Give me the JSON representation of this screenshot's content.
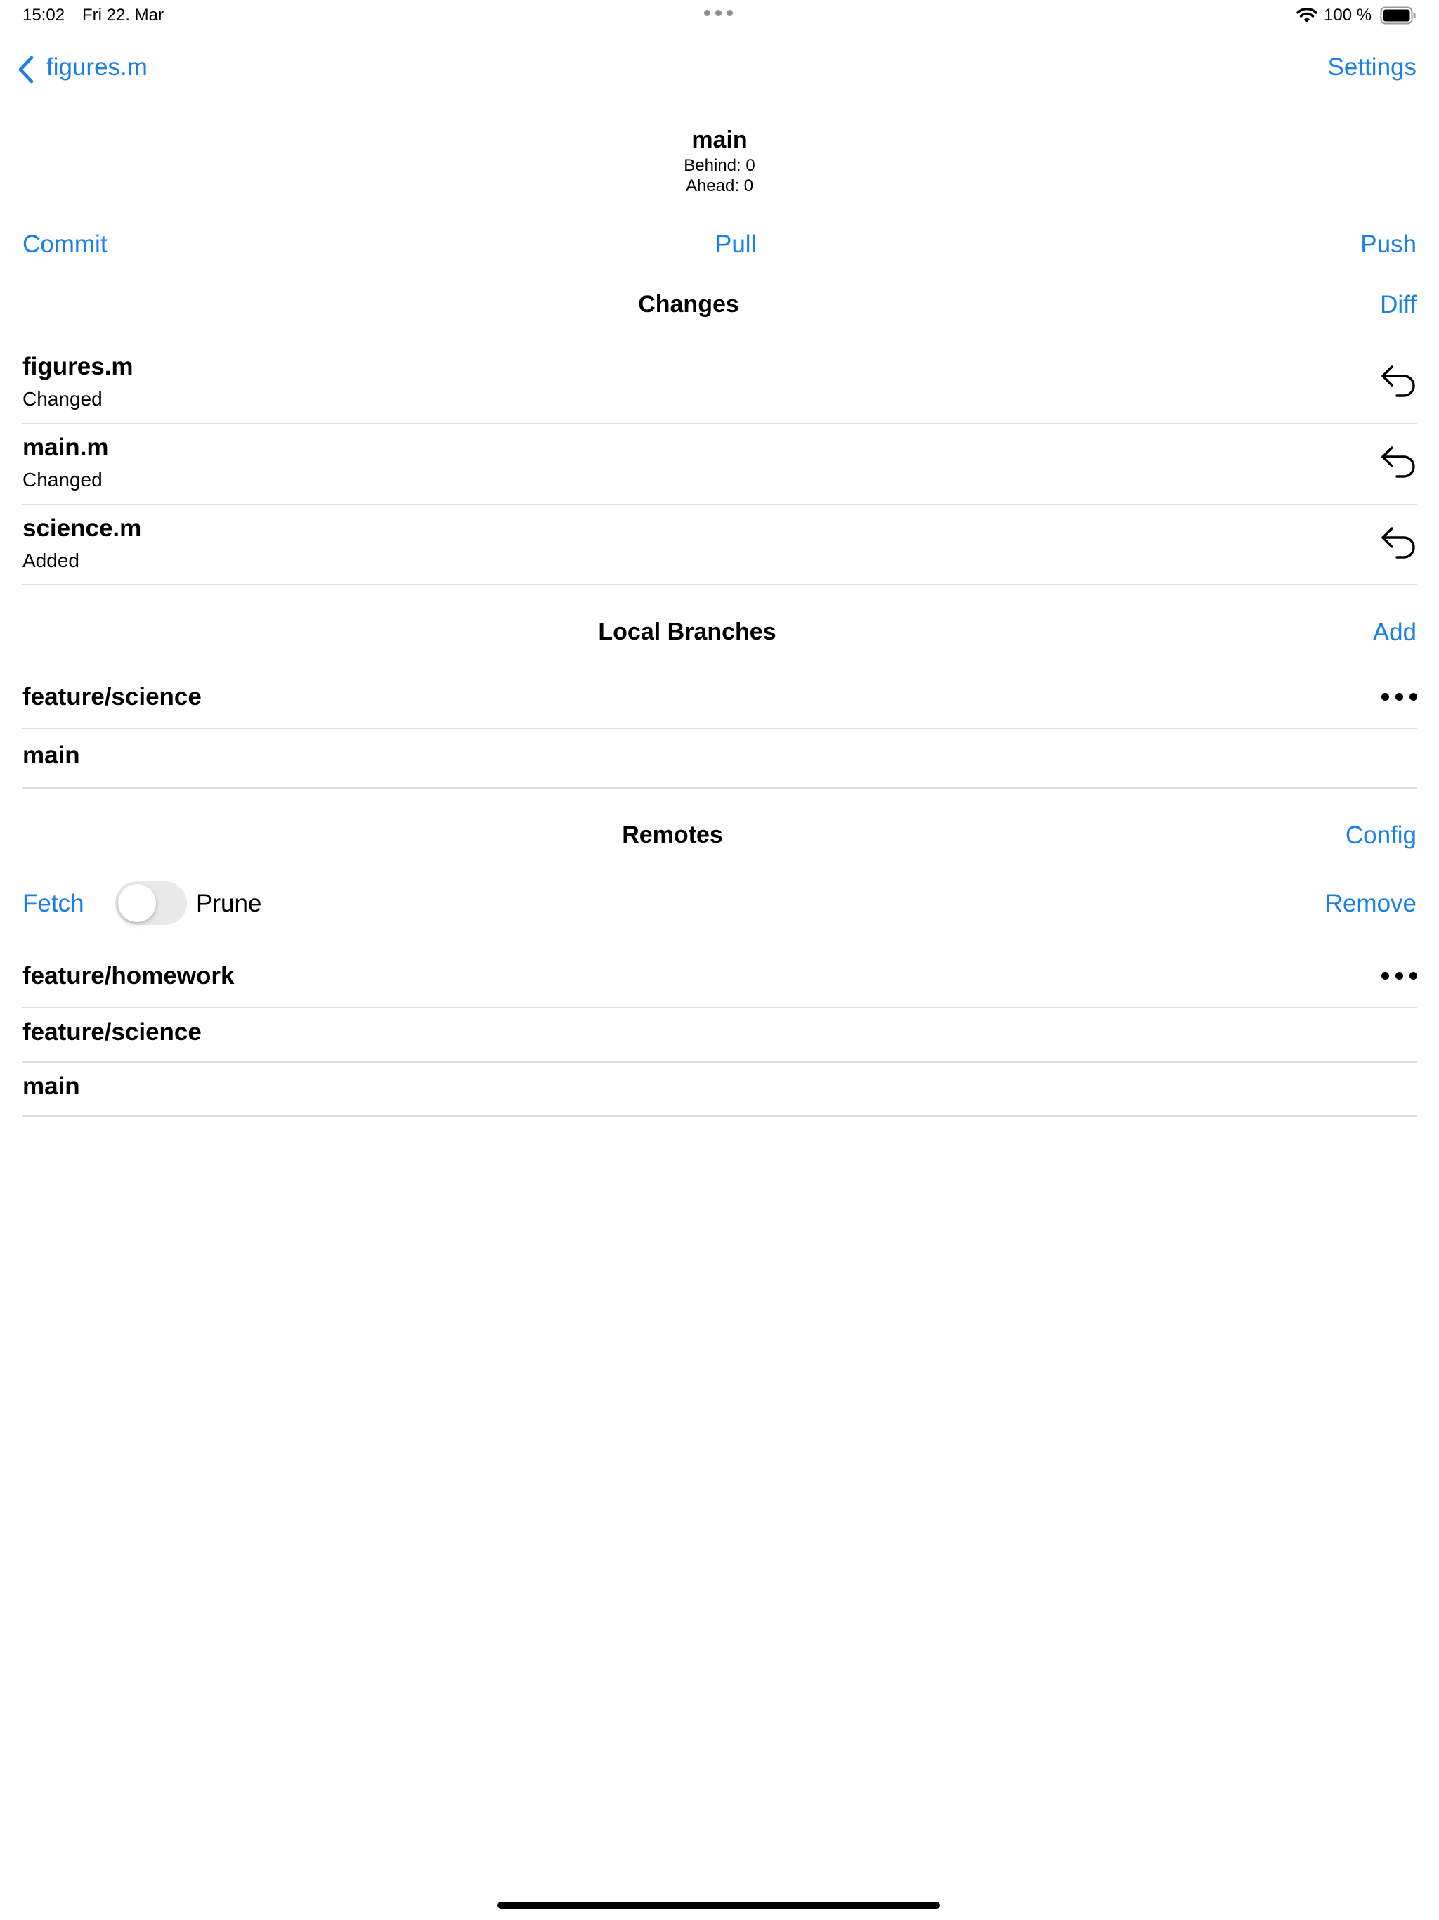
{
  "status_bar": {
    "time": "15:02",
    "date": "Fri 22. Mar",
    "battery": "100 %",
    "icons": [
      "multitasking-dots-icon",
      "wifi-icon",
      "battery-icon"
    ]
  },
  "nav": {
    "back_label": "figures.m",
    "settings_label": "Settings"
  },
  "branch": {
    "name": "main",
    "behind": "Behind: 0",
    "ahead": "Ahead: 0"
  },
  "actions": {
    "commit": "Commit",
    "pull": "Pull",
    "push": "Push"
  },
  "changes": {
    "title": "Changes",
    "action": "Diff",
    "items": [
      {
        "file": "figures.m",
        "status": "Changed"
      },
      {
        "file": "main.m",
        "status": "Changed"
      },
      {
        "file": "science.m",
        "status": "Added"
      }
    ]
  },
  "local_branches": {
    "title": "Local Branches",
    "action": "Add",
    "items": [
      "feature/science",
      "main"
    ]
  },
  "remotes": {
    "title": "Remotes",
    "action": "Config",
    "fetch": "Fetch",
    "prune_label": "Prune",
    "prune_enabled": false,
    "remove": "Remove",
    "items": [
      "feature/homework",
      "feature/science",
      "main"
    ]
  },
  "colors": {
    "accent": "#1a7fe8",
    "text": "#000000",
    "divider": "#dedee2",
    "toggle_off": "#e9e9ea"
  }
}
